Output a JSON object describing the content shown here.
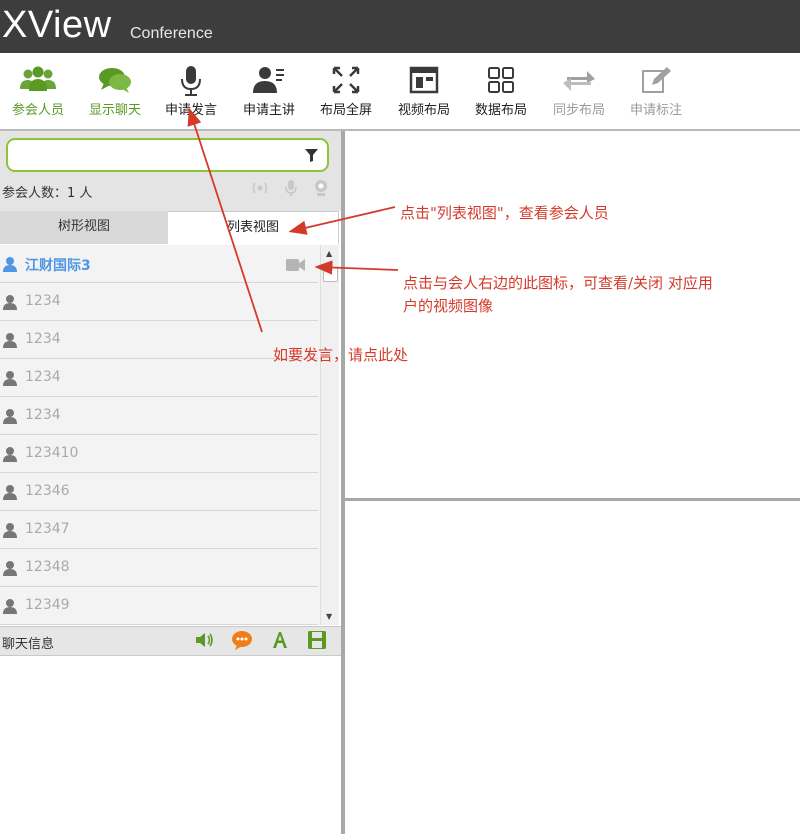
{
  "app": {
    "brand": "XView",
    "subtitle": "Conference"
  },
  "toolbar": {
    "items": [
      {
        "key": "participants",
        "label": "参会人员",
        "icon": "participants-icon"
      },
      {
        "key": "chat",
        "label": "显示聊天",
        "icon": "chat-bubbles-icon"
      },
      {
        "key": "speak",
        "label": "申请发言",
        "icon": "microphone-icon"
      },
      {
        "key": "host",
        "label": "申请主讲",
        "icon": "presenter-icon"
      },
      {
        "key": "fullscreen",
        "label": "布局全屏",
        "icon": "fullscreen-icon"
      },
      {
        "key": "video_layout",
        "label": "视频布局",
        "icon": "video-layout-icon"
      },
      {
        "key": "data_layout",
        "label": "数据布局",
        "icon": "grid-layout-icon"
      },
      {
        "key": "sync_layout",
        "label": "同步布局",
        "icon": "sync-icon"
      },
      {
        "key": "annotate",
        "label": "申请标注",
        "icon": "edit-icon"
      }
    ],
    "colors": {
      "active": "#5a9a23",
      "normal": "#222222",
      "disabled": "#9a9a9a"
    }
  },
  "search": {
    "value": "",
    "placeholder": ""
  },
  "participants": {
    "count_label": "参会人数：1 人",
    "tabs": {
      "tree": "树形视图",
      "list": "列表视图"
    },
    "users": [
      {
        "name": "江财国际3",
        "active": true
      },
      {
        "name": "1234",
        "active": false
      },
      {
        "name": "1234",
        "active": false
      },
      {
        "name": "1234",
        "active": false
      },
      {
        "name": "1234",
        "active": false
      },
      {
        "name": "123410",
        "active": false
      },
      {
        "name": "12346",
        "active": false
      },
      {
        "name": "12347",
        "active": false
      },
      {
        "name": "12348",
        "active": false
      },
      {
        "name": "12349",
        "active": false
      }
    ]
  },
  "chat": {
    "title": "聊天信息"
  },
  "annotations": {
    "list_view": "点击\"列表视图\"，查看参会人员",
    "camera_line1": "点击与会人右边的此图标，可查看/关闭 对应用",
    "camera_line2": "户的视频图像",
    "speak": "如要发言，请点此处",
    "color": "#d43a2a"
  }
}
